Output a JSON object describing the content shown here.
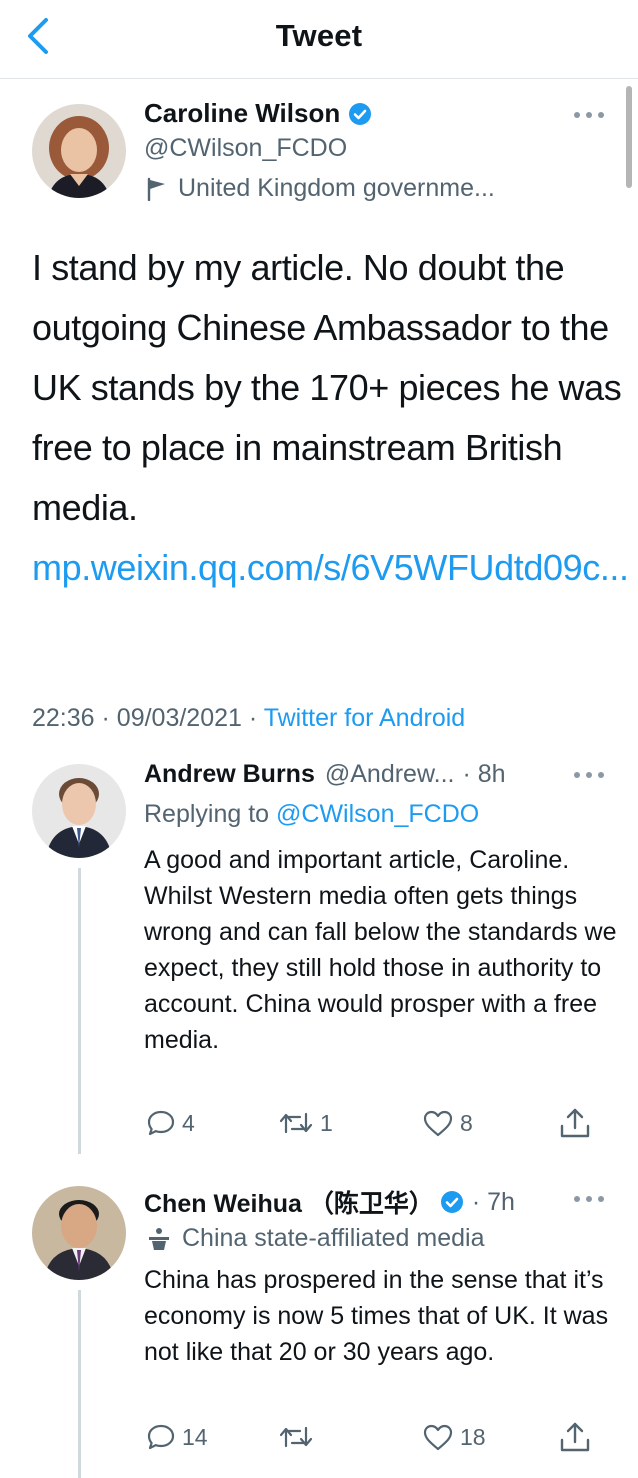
{
  "header": {
    "title": "Tweet"
  },
  "tweet": {
    "author_name": "Caroline Wilson",
    "author_handle": "@CWilson_FCDO",
    "author_label": "United Kingdom governme...",
    "text": "I stand by my article. No doubt the outgoing Chinese Ambassador to the UK stands by the 170+ pieces he was free to place in mainstream British media.",
    "link": "mp.weixin.qq.com/s/6V5WFUdtd09c...",
    "time": "22:36",
    "date": "09/03/2021",
    "source": "Twitter for Android",
    "separator": "·"
  },
  "replies": [
    {
      "name": "Andrew Burns",
      "handle": "@Andrew...",
      "time": "· 8h",
      "replying_prefix": "Replying to",
      "replying_to": "@CWilson_FCDO",
      "text": "A good and important article, Caroline.  Whilst Western media often gets things wrong and can fall below the  standards we expect, they still hold those in authority to account.  China would prosper with a free media.",
      "counts": {
        "replies": "4",
        "retweets": "1",
        "likes": "8"
      }
    },
    {
      "name": "Chen Weihua （陈卫华）",
      "time": "· 7h",
      "label": "China state-affiliated media",
      "text": "China has prospered in the sense that it’s economy is now 5 times that of UK.  It was not like that 20 or 30 years ago.",
      "counts": {
        "replies": "14",
        "retweets": "",
        "likes": "18"
      }
    }
  ],
  "icons": {
    "back": "chevron-left-icon",
    "verified": "verified-badge-icon",
    "government": "flag-icon",
    "state_media": "podium-icon",
    "more": "more-icon",
    "reply": "comment-icon",
    "retweet": "retweet-icon",
    "like": "heart-icon",
    "share": "share-icon"
  },
  "colors": {
    "accent": "#1d9bf0",
    "muted": "#536471",
    "text": "#0f1419",
    "divider": "#e1e4e6"
  }
}
